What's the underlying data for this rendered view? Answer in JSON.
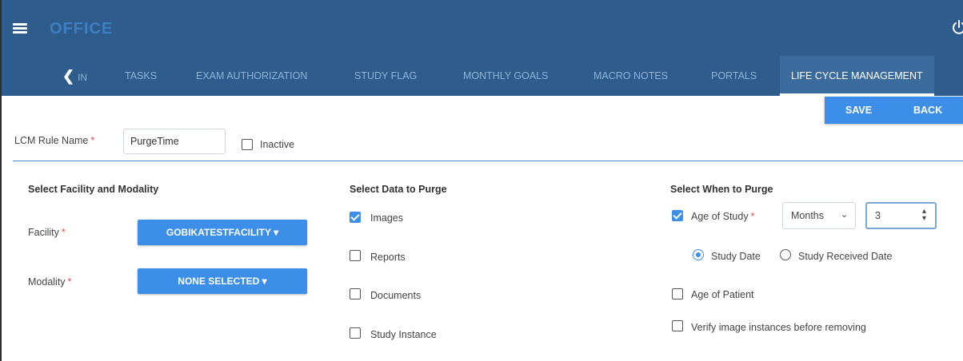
{
  "header": {
    "brand": "OFFICE",
    "menu_icon": "hamburger-menu-icon",
    "power_icon": "power-icon"
  },
  "nav": {
    "back_label": "IN",
    "tabs": [
      {
        "label": "TASKS"
      },
      {
        "label": "EXAM AUTHORIZATION"
      },
      {
        "label": "STUDY FLAG"
      },
      {
        "label": "MONTHLY GOALS"
      },
      {
        "label": "MACRO NOTES"
      },
      {
        "label": "PORTALS"
      },
      {
        "label": "LIFE CYCLE MANAGEMENT",
        "active": true
      }
    ]
  },
  "actions": {
    "save_label": "SAVE",
    "back_label": "BACK"
  },
  "rule": {
    "name_label": "LCM Rule Name",
    "name_value": "PurgeTime",
    "inactive_label": "Inactive",
    "inactive_checked": false
  },
  "facility_section": {
    "title": "Select Facility and Modality",
    "facility_label": "Facility",
    "facility_value": "GOBIKATESTFACILITY",
    "modality_label": "Modality",
    "modality_value": "NONE SELECTED"
  },
  "data_section": {
    "title": "Select Data to Purge",
    "options": [
      {
        "label": "Images",
        "checked": true
      },
      {
        "label": "Reports",
        "checked": false
      },
      {
        "label": "Documents",
        "checked": false
      },
      {
        "label": "Study Instance",
        "checked": false
      }
    ]
  },
  "when_section": {
    "title": "Select When to Purge",
    "age_of_study_label": "Age of Study",
    "age_of_study_checked": true,
    "unit_value": "Months",
    "amount_value": "3",
    "study_date_label": "Study Date",
    "study_received_label": "Study Received Date",
    "selected_date": "Study Date",
    "age_of_patient_label": "Age of Patient",
    "age_of_patient_checked": false,
    "verify_label": "Verify image instances before removing",
    "verify_checked": false
  },
  "colors": {
    "header_bg": "#2e5d8d",
    "accent": "#3c8ee8",
    "required": "#e54848"
  }
}
